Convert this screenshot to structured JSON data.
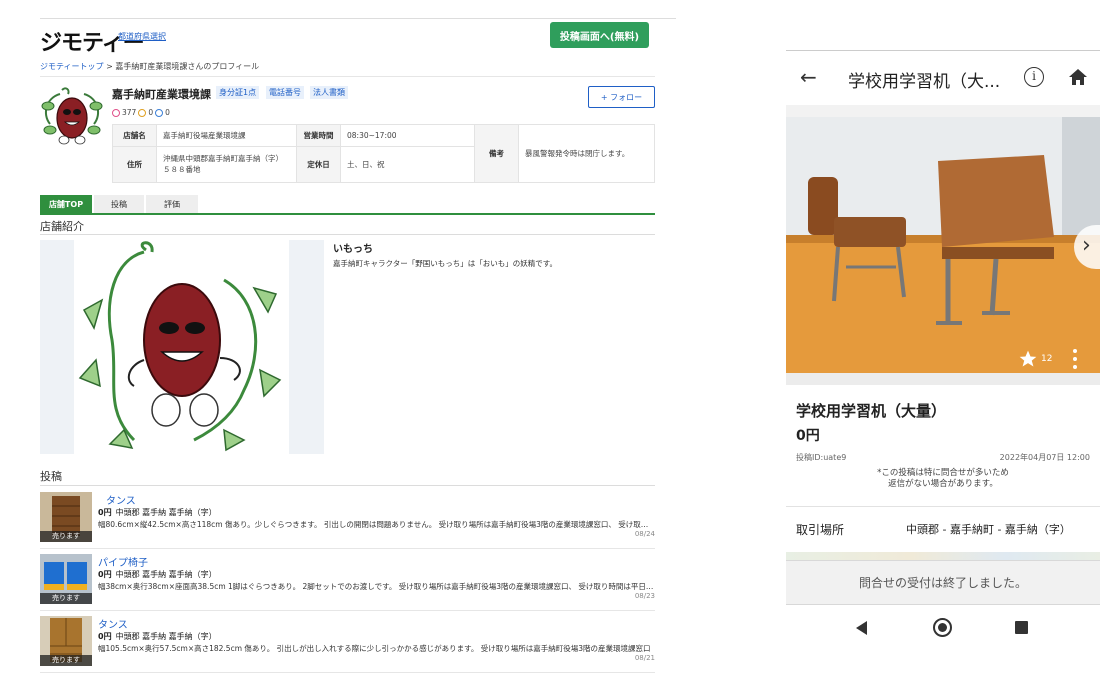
{
  "desktop": {
    "logo": "ジモティー",
    "pref_link": "都道府県選択",
    "post_button": "投稿画面へ(無料)",
    "breadcrumb": {
      "home": "ジモティートップ",
      "separator": ">",
      "current": "嘉手納町産業環境課さんのプロフィール"
    },
    "profile": {
      "name": "嘉手納町産業環境課",
      "badges": [
        "身分証1点",
        "電話番号",
        "法人書類"
      ],
      "count_good": "377",
      "count_normal": "0",
      "count_bad": "0",
      "follow_button": "+ フォロー"
    },
    "info": {
      "store_label": "店舗名",
      "store_value": "嘉手納町役場産業環境課",
      "hours_label": "営業時間",
      "hours_value": "08:30~17:00",
      "address_label": "住所",
      "address_value": "沖縄県中頭郡嘉手納町嘉手納（字）５８８番地",
      "closed_label": "定休日",
      "closed_value": "土、日、祝",
      "remarks_label": "備考",
      "remarks_value": "暴風警報発令時は閉庁します。"
    },
    "tabs": [
      "店舗TOP",
      "投稿",
      "評価"
    ],
    "intro_section": "店舗紹介",
    "intro_title": "いもっち",
    "intro_text": "嘉手納町キャラクター「野国いもっち」は「おいも」の妖精です。",
    "posts_section": "投稿",
    "sold_label": "売ります",
    "posts": [
      {
        "title": "タンス",
        "price": "0円",
        "location": "中頭郡 嘉手納 嘉手納（字）",
        "desc": "幅80.6cm×縦42.5cm×高さ118cm 傷あり。少しぐらつきます。 引出しの開閉は問題ありません。 受け取り場所は嘉手納町役場3階の産業環境課窓口、 受け取り時間は平日のみ",
        "date": "08/24"
      },
      {
        "title": "パイプ椅子",
        "price": "0円",
        "location": "中頭郡 嘉手納 嘉手納（字）",
        "desc": "幅38cm×奥行38cm×座面高38.5cm 1脚はぐらつきあり。 2脚セットでのお渡しです。 受け取り場所は嘉手納町役場3階の産業環境課窓口、 受け取り時間は平日のみ",
        "date": "08/23"
      },
      {
        "title": "タンス",
        "price": "0円",
        "location": "中頭郡 嘉手納 嘉手納（字）",
        "desc": "幅105.5cm×奥行57.5cm×高さ182.5cm 傷あり。 引出しが出し入れする際に少し引っかかる感じがあります。 受け取り場所は嘉手納町役場3階の産業環境課窓口",
        "date": "08/21"
      }
    ]
  },
  "phone": {
    "header_title": "学校用学習机（大...",
    "favorite_count": "12",
    "item_title": "学校用学習机（大量）",
    "price": "0円",
    "post_id": "投稿ID:uate9",
    "post_date": "2022年04月07日 12:00",
    "note_line1": "*この投稿は特に問合せが多いため",
    "note_line2": "返信がない場合があります。",
    "place_label": "取引場所",
    "place_value": "中頭郡 - 嘉手納町 - 嘉手納（字）",
    "closed_message": "問合せの受付は終了しました。"
  },
  "colors": {
    "accent_green": "#2f9e5c",
    "link_blue": "#1f5fc6",
    "tab_green": "#2f8f3e"
  }
}
